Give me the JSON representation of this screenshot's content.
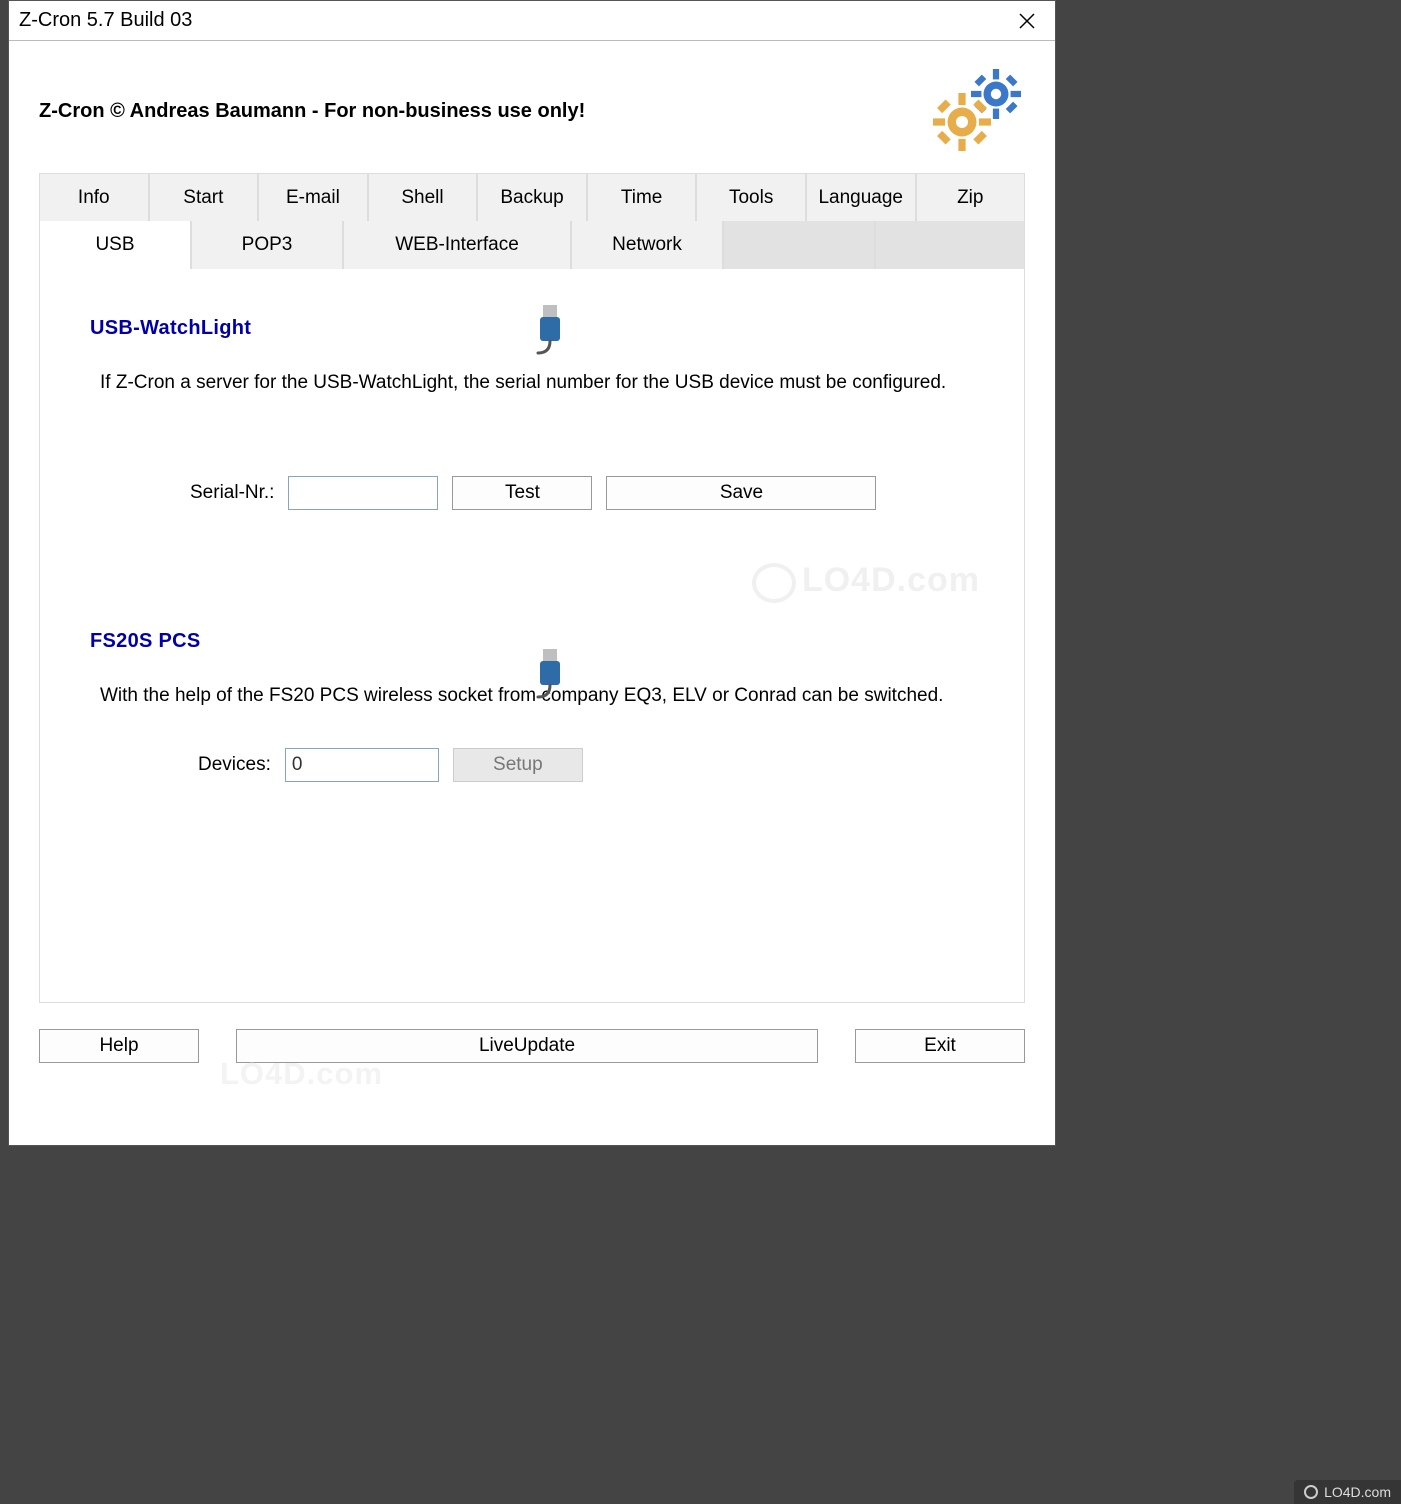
{
  "window": {
    "title": "Z-Cron 5.7 Build 03"
  },
  "header": {
    "text": "Z-Cron © Andreas Baumann - For non-business use only!"
  },
  "tabsRow1": [
    "Info",
    "Start",
    "E-mail",
    "Shell",
    "Backup",
    "Time",
    "Tools",
    "Language",
    "Zip"
  ],
  "tabsRow2": [
    "USB",
    "POP3",
    "WEB-Interface",
    "Network",
    "",
    ""
  ],
  "activeTab": "USB",
  "usb": {
    "section1Title": "USB-WatchLight",
    "section1Desc": "If Z-Cron a server for the USB-WatchLight, the serial number for the USB device must be configured.",
    "serialLabel": "Serial-Nr.:",
    "serialValue": "",
    "testLabel": "Test",
    "saveLabel": "Save",
    "section2Title": "FS20S PCS",
    "section2Desc": "With the help of the FS20 PCS wireless socket from company EQ3, ELV or Conrad can be switched.",
    "devicesLabel": "Devices:",
    "devicesValue": "0",
    "setupLabel": "Setup"
  },
  "buttons": {
    "help": "Help",
    "liveUpdate": "LiveUpdate",
    "exit": "Exit"
  },
  "watermark": "LO4D.com",
  "footerBadge": "LO4D.com"
}
